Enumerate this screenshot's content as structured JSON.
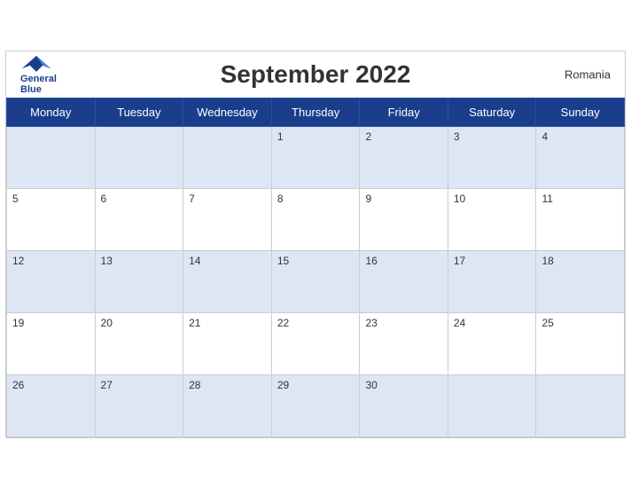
{
  "header": {
    "title": "September 2022",
    "country": "Romania",
    "logo_line1": "General",
    "logo_line2": "Blue"
  },
  "weekdays": [
    "Monday",
    "Tuesday",
    "Wednesday",
    "Thursday",
    "Friday",
    "Saturday",
    "Sunday"
  ],
  "weeks": [
    [
      "",
      "",
      "",
      "1",
      "2",
      "3",
      "4"
    ],
    [
      "5",
      "6",
      "7",
      "8",
      "9",
      "10",
      "11"
    ],
    [
      "12",
      "13",
      "14",
      "15",
      "16",
      "17",
      "18"
    ],
    [
      "19",
      "20",
      "21",
      "22",
      "23",
      "24",
      "25"
    ],
    [
      "26",
      "27",
      "28",
      "29",
      "30",
      "",
      ""
    ]
  ]
}
